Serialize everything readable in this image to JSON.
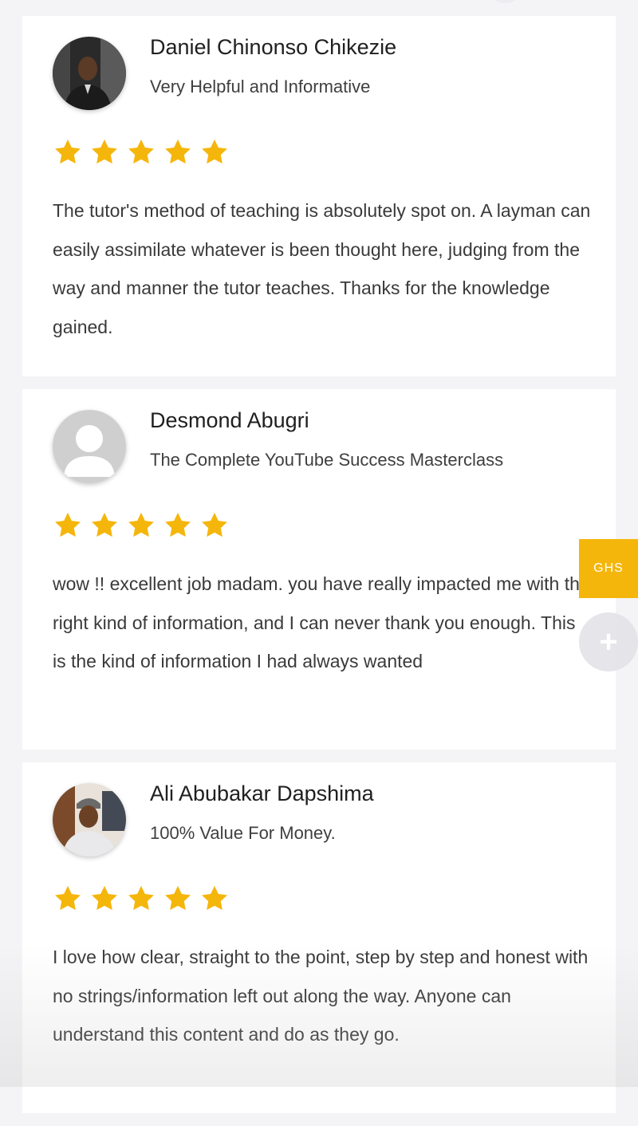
{
  "reviews": [
    {
      "name": "Daniel Chinonso Chikezie",
      "course": "Very Helpful and Informative",
      "rating": 5,
      "text": "The tutor's method of teaching is absolutely spot on. A layman can easily assimilate whatever is been thought here, judging from the way and manner the tutor teaches. Thanks for the knowledge gained."
    },
    {
      "name": "Desmond Abugri",
      "course": "The Complete YouTube Success Masterclass",
      "rating": 5,
      "text": "wow !! excellent job madam. you have really impacted me with the right kind of information, and I can never thank you enough. This is the kind of information I had always wanted"
    },
    {
      "name": "Ali Abubakar Dapshima",
      "course": "100% Value For Money.",
      "rating": 5,
      "text": "I love how clear, straight to the point, step by step and honest with no strings/information left out along the way. Anyone can understand this content and do as they go."
    }
  ],
  "currency_tab": {
    "label": "GHS"
  },
  "plus_button": {
    "icon": "plus-icon",
    "label": "+"
  },
  "colors": {
    "star": "#f5b60c",
    "currency_tab": "#f5b60c",
    "card": "#ffffff",
    "background": "#f4f4f6"
  }
}
